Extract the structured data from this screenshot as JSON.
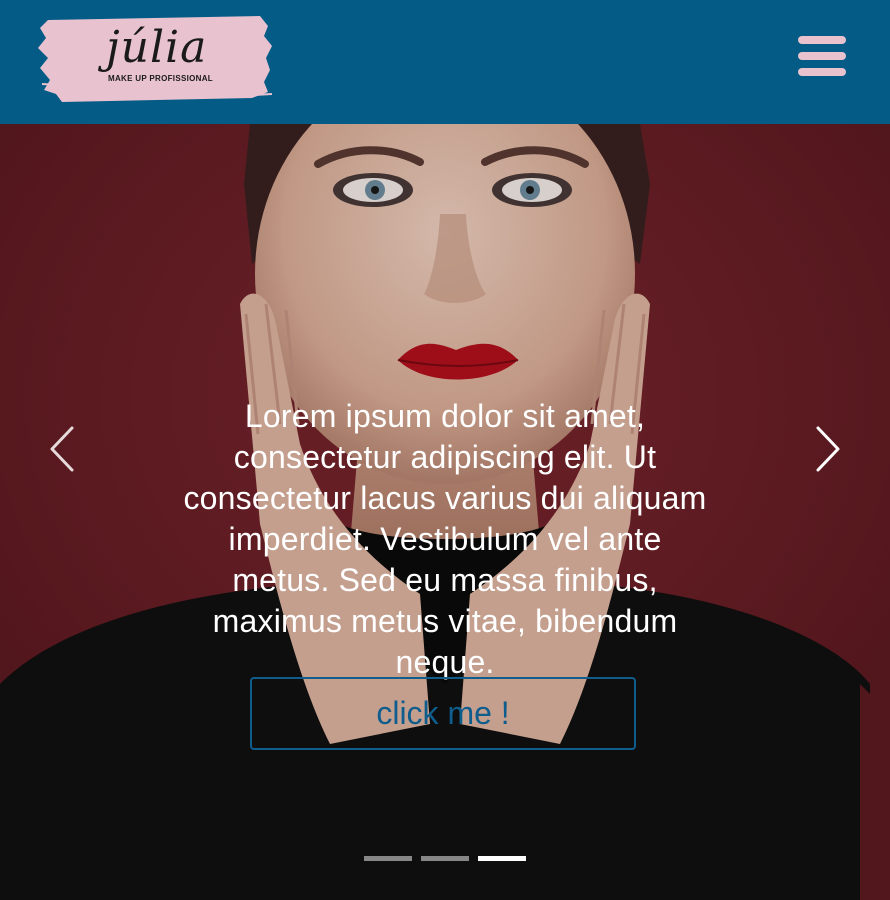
{
  "header": {
    "logo": {
      "wordmark": "júlia",
      "tagline": "MAKE UP PROFISSIONAL"
    },
    "menu_icon": "hamburger-menu-icon",
    "colors": {
      "background": "#035b86",
      "accent": "#e8c2cf"
    }
  },
  "hero": {
    "caption": "Lorem ipsum dolor sit amet, consectetur adipiscing elit. Ut consectetur lacus varius dui aliquam imperdiet. Vestibulum vel ante metus. Sed eu massa finibus, maximus metus vitae, bibendum neque.",
    "cta_label": "click me !",
    "prev_icon": "chevron-left-icon",
    "next_icon": "chevron-right-icon",
    "slides_total": 3,
    "active_slide": 3,
    "colors": {
      "background": "#6f2028",
      "cta": "#0f5d8d"
    }
  }
}
